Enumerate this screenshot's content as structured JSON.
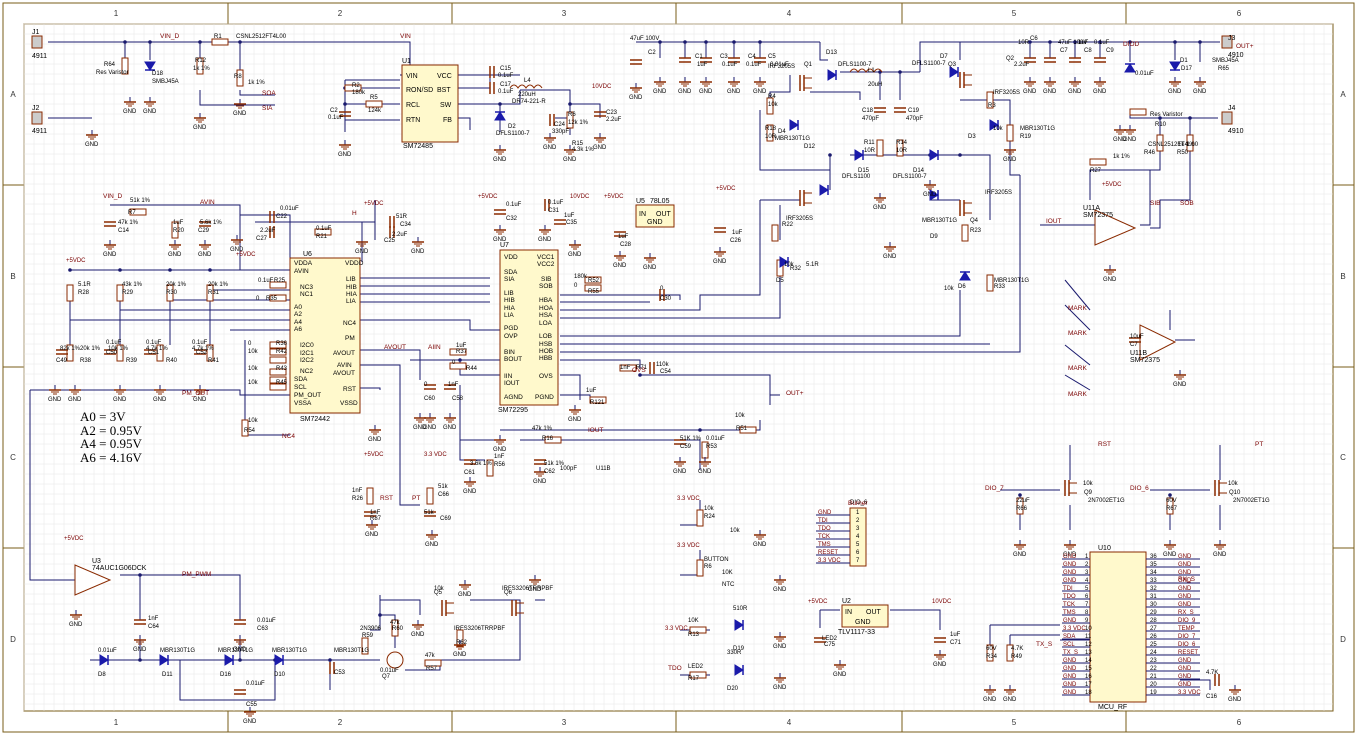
{
  "border": {
    "cols": [
      "1",
      "2",
      "3",
      "4",
      "5",
      "6"
    ],
    "rows": [
      "A",
      "B",
      "C",
      "D"
    ]
  },
  "notes": [
    "A0 = 3V",
    "A2 = 0.95V",
    "A4 = 0.95V",
    "A6 = 4.16V"
  ],
  "components": {
    "connectors": {
      "J1": "J1",
      "J1v": "4911",
      "J2": "J2",
      "J2v": "4911",
      "J3": "J3",
      "J3v": "4910",
      "J4": "J4",
      "J4v": "4910"
    },
    "ics": {
      "U1": "U1",
      "U1part": "SM72485",
      "U1pins": [
        "VIN",
        "RON/SD",
        "RCL",
        "RTN",
        "VCC",
        "BST",
        "SW",
        "FB"
      ],
      "U5": "U5",
      "U5part": "78L05",
      "U5pins": [
        "IN",
        "OUT",
        "GND"
      ],
      "U6": "U6",
      "U6part": "SM72442",
      "U6pins": [
        "VDDA",
        "AVIN",
        "NC3",
        "NC1",
        "A0",
        "A2",
        "A4",
        "A6",
        "I2C0",
        "I2C1",
        "I2C2",
        "NC2",
        "SDA",
        "SCL",
        "PM_OUT",
        "VSSA",
        "VDDD",
        "LIB",
        "HIB",
        "HIA",
        "LIA",
        "NC4",
        "PM",
        "AVOUT",
        "AVIN",
        "AVOUT",
        "RST",
        "VSSD"
      ],
      "U7": "U7",
      "U7part": "SM72295",
      "U7pins": [
        "VDD",
        "SDA",
        "SIA",
        "LIB",
        "HIB",
        "HIA",
        "LIA",
        "PGD",
        "OVP",
        "BIN",
        "BOUT",
        "IIN",
        "IOUT",
        "AGND",
        "VCC1",
        "VCC2",
        "SIB",
        "SOB",
        "HBA",
        "HOA",
        "HSA",
        "LOA",
        "LOB",
        "HSB",
        "HOB",
        "HBB",
        "OVS",
        "PGND"
      ],
      "U2": "U2",
      "U2part": "TLV1117-33",
      "U2pins": [
        "IN",
        "OUT",
        "GND"
      ],
      "U3": "U3",
      "U3part": "74AUC1G06DCK",
      "U10": "U10",
      "U10part": "MCU_RF",
      "U11A": "U11A",
      "U11part": "SM72375",
      "U11B": "U11B",
      "U11Bpart": "SM72375"
    },
    "labels": [
      "VIN_D",
      "VIN",
      "VIN_D",
      "AVIN",
      "SIA",
      "SOA",
      "H",
      "NC4",
      "PM_OUT",
      "AVOUT",
      "AIIN",
      "RST",
      "PT",
      "OVS",
      "IOUT",
      "OUT+",
      "OUT+",
      "PM_PWM",
      "DIOD",
      "IOUT",
      "SIB",
      "SOB",
      "RST",
      "PT",
      "DIO_7",
      "DIO_6",
      "TDO",
      "Burner",
      "MARK",
      "MARK",
      "MARK",
      "MARK",
      "TX_S",
      "RX_S"
    ],
    "passives": [
      "R64",
      "Res Varistor",
      "D18",
      "SMBJ45A",
      "R1",
      "CSNL2512FT4L00",
      "R12",
      "1k 1%",
      "R8",
      "1k 1%",
      "R2",
      "180k",
      "R5",
      "124k",
      "C2",
      "0.1uF",
      "C15",
      "0.1uF",
      "C17",
      "0.1uF",
      "L4",
      "220uH",
      "DR74-221-R",
      "D2",
      "DFLS1100-7",
      "R6",
      "12k 1%",
      "R15",
      "4.3k 1%",
      "C24",
      "330pF",
      "C23",
      "2.2uF",
      "C2",
      "47uF 100V",
      "C1",
      "1uF",
      "C3",
      "0.1uF",
      "C4",
      "0.1uF",
      "C5",
      "0.01uF",
      "D13",
      "DFLS1100-7",
      "Q1",
      "IRF3205S",
      "R4",
      "10k",
      "R18",
      "10R",
      "D4",
      "MBR130T1G",
      "D12",
      "L1",
      "20uH",
      "C18",
      "470pF",
      "C19",
      "470pF",
      "R11",
      "10R",
      "R14",
      "10R",
      "D15",
      "DFLS1100",
      "D14",
      "DFLS1100-7",
      "D7",
      "DFLS1100-7",
      "Q3",
      "IRF3205S",
      "R3",
      "10k",
      "D3",
      "MBR130T1G",
      "R19",
      "10R",
      "C6",
      "47uF 100V",
      "C7",
      "1uF",
      "C8",
      "0.1uF",
      "C9",
      "0.01uF",
      "D1",
      "D17",
      "SMBJ45A",
      "R65",
      "Res Varistor",
      "R10",
      "CSNL2512FT4L00",
      "R46",
      "1k 1%",
      "R50",
      "1k 1%",
      "R27",
      "51k 1%",
      "R7",
      "47k 1%",
      "C14",
      "1uF",
      "R20",
      "5.6k 1%",
      "C29",
      "0.01uF",
      "C22",
      "2.2uF",
      "C27",
      "0.1uF",
      "R21",
      "51R",
      "C34",
      "2.2uF",
      "C25",
      "0.1uF",
      "C32",
      "0.1uF",
      "C31",
      "1uF",
      "C35",
      "1uF",
      "C28",
      "1uF",
      "C26",
      "2.2uF",
      "Q2",
      "IRF3205S",
      "R22",
      "10k",
      "R32",
      "5.1R",
      "D5",
      "MBR130T1G",
      "D9",
      "IRF3205S",
      "Q4",
      "R23",
      "10k",
      "D6",
      "MBR130T1G",
      "R33",
      "5.1R",
      "R28",
      "43k 1%",
      "R29",
      "20k 1%",
      "R30",
      "20k 1%",
      "R31",
      "20k 1%",
      "R38",
      "10k 1%",
      "R39",
      "4.7k 1%",
      "R40",
      "4.7k 1%",
      "R41",
      "82k 1%",
      "C49",
      "0.1uF",
      "C50",
      "0.1uF",
      "C51",
      "0.1uF",
      "C52",
      "0.1uF",
      "R25",
      "0",
      "R35",
      "0",
      "R36",
      "10k",
      "R42",
      "10k",
      "R43",
      "10k",
      "R45",
      "10k",
      "R54",
      "180k",
      "R52",
      "0",
      "R55",
      "0",
      "C30",
      "1uF",
      "R37",
      "0",
      "R44",
      "0",
      "C60",
      "1nF",
      "C58",
      "1nF",
      "R71",
      "110k",
      "C54",
      "1uF",
      "R121",
      "10k",
      "R51",
      "47k 1%",
      "R16",
      "51K 1%",
      "C59",
      "0.01uF",
      "R53",
      "3.6k 1%",
      "C61",
      "1nF",
      "R56",
      "51k 1%",
      "C62",
      "1nF",
      "R26",
      "51k",
      "C66",
      "1nF",
      "R87",
      "51k",
      "C69",
      "1nF",
      "C64",
      "0.01uF",
      "C63",
      "0.01uF",
      "D8",
      "MBR130T1G",
      "D11",
      "MBR130T1G",
      "D16",
      "MBR130T1G",
      "D10",
      "MBR130T1G",
      "C53",
      "0.01uF",
      "C55",
      "0.01uF",
      "Q7",
      "2N3906",
      "R59",
      "47k",
      "R60",
      "47k",
      "R57",
      "10k",
      "Q5",
      "IRFS3206TRRPBF",
      "Q6",
      "IRFS3206TRRPBF",
      "R62",
      "10k",
      "R24",
      "10k",
      "BUTTON",
      "R6",
      "10K",
      "NTC",
      "10K",
      "R13",
      "510R",
      "D19",
      "LED2",
      "R17",
      "330R",
      "D20",
      "LED2",
      "C75",
      "1uF",
      "C71",
      "22uF",
      "R66",
      "10k",
      "Q9",
      "2N7002ET1G",
      "60V",
      "R67",
      "10k",
      "Q10",
      "2N7002ET1G",
      "60V",
      "R34",
      "4.7K",
      "R49",
      "4.7K",
      "C16",
      "10uF",
      "C7",
      "100pF",
      "U11B"
    ],
    "headers": {
      "burner": [
        "GND",
        "TDI",
        "TDO",
        "TCK",
        "TMS",
        "RESET",
        "3.3 VDC"
      ],
      "mcu_left": [
        "GND",
        "GND",
        "GND",
        "GND",
        "TDI",
        "TDO",
        "TCK",
        "TMS",
        "GND",
        "3.3 VDC",
        "SDA",
        "SCL",
        "TX_S",
        "GND",
        "GND",
        "GND",
        "GND",
        "GND"
      ],
      "mcu_right": [
        "GND",
        "GND",
        "GND",
        "GND",
        "GND",
        "GND",
        "GND",
        "RX_S",
        "DIO_9",
        "TEMP",
        "DIO_7",
        "DIO_6",
        "RESET",
        "GND",
        "GND",
        "GND",
        "GND",
        "3.3 VDC"
      ]
    },
    "supplies": [
      "+5VDC",
      "+5VDC",
      "10VDC",
      "10VDC",
      "+5VDC",
      "+5VDC",
      "+5VDC",
      "+5VDC",
      "+5VDC",
      "+5VDC",
      "+5VDC",
      "3.3 VDC",
      "3.3 VDC",
      "3.3 VDC",
      "10VDC",
      "3.3 VDC",
      "+5VDC"
    ]
  }
}
